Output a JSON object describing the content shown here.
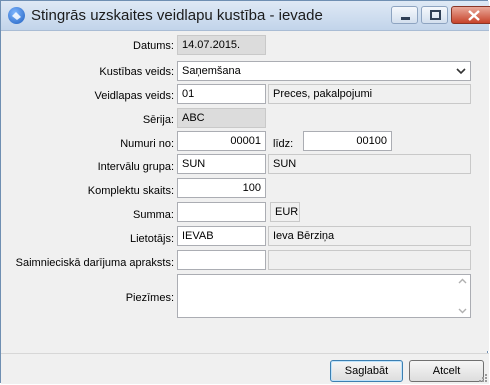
{
  "window": {
    "title": "Stingrās uzskaites veidlapu kustība - ievade",
    "icon": "app-logo-icon"
  },
  "form": {
    "date_label": "Datums:",
    "date_value": "14.07.2015.",
    "movement_type_label": "Kustības veids:",
    "movement_type_value": "Saņemšana",
    "form_type_label": "Veidlapas veids:",
    "form_type_code": "01",
    "form_type_name": "Preces, pakalpojumi",
    "series_label": "Sērija:",
    "series_value": "ABC",
    "numbers_from_label": "Numuri no:",
    "numbers_from_value": "00001",
    "numbers_to_label": "līdz:",
    "numbers_to_value": "00100",
    "interval_group_label": "Intervālu grupa:",
    "interval_group_code": "SUN",
    "interval_group_name": "SUN",
    "sets_count_label": "Komplektu skaits:",
    "sets_count_value": "100",
    "amount_label": "Summa:",
    "amount_value": "",
    "currency_value": "EUR",
    "user_label": "Lietotājs:",
    "user_code": "IEVAB",
    "user_name": "Ieva  Bērziņa",
    "transaction_desc_label": "Saimnieciskā darījuma apraksts:",
    "transaction_desc_code": "",
    "transaction_desc_name": "",
    "notes_label": "Piezīmes:",
    "notes_value": ""
  },
  "buttons": {
    "save_label": "Saglabāt",
    "cancel_label": "Atcelt"
  },
  "colors": {
    "title_bar": "#c2d4ea",
    "close_button": "#c7432b",
    "background": "#f0f0f0"
  }
}
